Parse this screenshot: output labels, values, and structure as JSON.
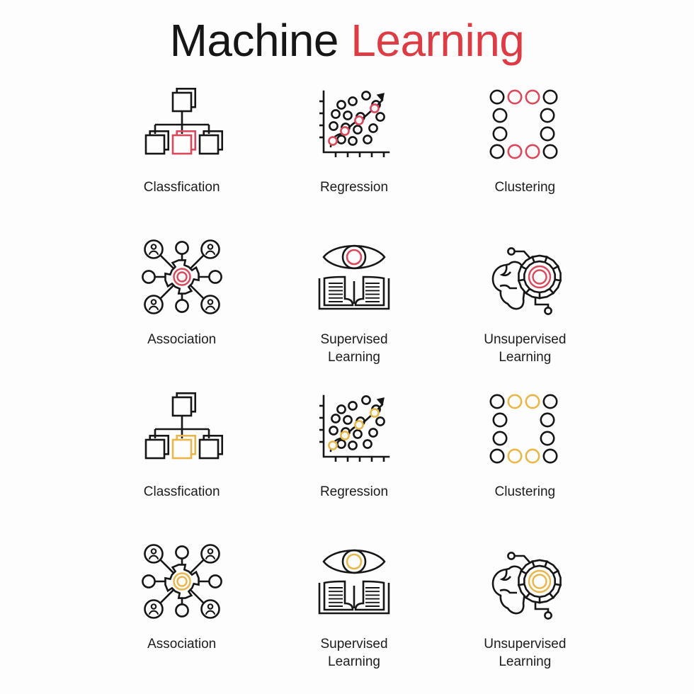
{
  "title": {
    "word_primary": "Machine",
    "word_accent": "Learning"
  },
  "colors": {
    "background": "#fdfdfd",
    "text": "#1c1c1c",
    "stroke_dark": "#161616",
    "accent_red": "#d9485b",
    "accent_red_title": "#dd3c44",
    "accent_amber": "#e8b64a"
  },
  "grid": {
    "columns": 3,
    "rows": 4,
    "cells": [
      {
        "icon": "classification-tree-icon",
        "label": "Classfication",
        "accent": "#d9485b"
      },
      {
        "icon": "regression-scatter-icon",
        "label": "Regression",
        "accent": "#d9485b"
      },
      {
        "icon": "clustering-circles-icon",
        "label": "Clustering",
        "accent": "#d9485b"
      },
      {
        "icon": "association-network-icon",
        "label": "Association",
        "accent": "#d9485b"
      },
      {
        "icon": "supervised-eye-book-icon",
        "label": "Supervised\nLearning",
        "accent": "#d9485b"
      },
      {
        "icon": "unsupervised-brain-gear-icon",
        "label": "Unsupervised\nLearning",
        "accent": "#d9485b"
      },
      {
        "icon": "classification-tree-icon",
        "label": "Classfication",
        "accent": "#e8b64a"
      },
      {
        "icon": "regression-scatter-icon",
        "label": "Regression",
        "accent": "#e8b64a"
      },
      {
        "icon": "clustering-circles-icon",
        "label": "Clustering",
        "accent": "#e8b64a"
      },
      {
        "icon": "association-network-icon",
        "label": "Association",
        "accent": "#e8b64a"
      },
      {
        "icon": "supervised-eye-book-icon",
        "label": "Supervised\nLearning",
        "accent": "#e8b64a"
      },
      {
        "icon": "unsupervised-brain-gear-icon",
        "label": "Unsupervised\nLearning",
        "accent": "#e8b64a"
      }
    ]
  },
  "icon_details": {
    "classification-tree-icon": {
      "description": "one parent stacked square on top, three child stacked squares below joined by connector lines; middle child uses accent color",
      "nodes": 4,
      "accent_node": "middle-child"
    },
    "regression-scatter-icon": {
      "description": "x/y axes with tick marks, ascending trend line ending in arrow, four accent-colored points on the line, thirteen dark scatter points",
      "trend_points": 4,
      "scatter_points": 13,
      "has_arrow": true
    },
    "clustering-circles-icon": {
      "description": "ring arrangement of circles, four rows; top and bottom rows have four circles with the two inner ones accent-colored, middle rows have two outer circles",
      "total_circles": 12,
      "accent_circles": 4
    },
    "association-network-icon": {
      "description": "central gear with accent double-ring hub, connected by spokes to four person avatars on diagonals and four plain circles at top, bottom, left and right",
      "avatars": 4,
      "plain_nodes": 4
    },
    "supervised-eye-book-icon": {
      "description": "eye outline with accent-colored iris ring above an open book with ruled text lines on both pages",
      "text_lines_per_page": 6
    },
    "unsupervised-brain-gear-icon": {
      "description": "brain outline at left beside a gear with accent double-ring hub, with circuit traces ending in small dot terminals",
      "terminals": 2
    }
  }
}
